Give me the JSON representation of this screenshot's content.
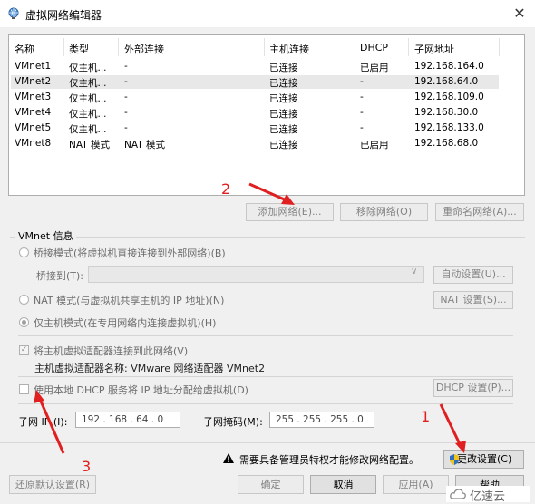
{
  "window": {
    "title": "虚拟网络编辑器",
    "close_glyph": "✕"
  },
  "table": {
    "columns": [
      "名称",
      "类型",
      "外部连接",
      "主机连接",
      "DHCP",
      "子网地址"
    ],
    "rows": [
      [
        "VMnet1",
        "仅主机...",
        "-",
        "已连接",
        "已启用",
        "192.168.164.0"
      ],
      [
        "VMnet2",
        "仅主机...",
        "-",
        "已连接",
        "-",
        "192.168.64.0"
      ],
      [
        "VMnet3",
        "仅主机...",
        "-",
        "已连接",
        "-",
        "192.168.109.0"
      ],
      [
        "VMnet4",
        "仅主机...",
        "-",
        "已连接",
        "-",
        "192.168.30.0"
      ],
      [
        "VMnet5",
        "仅主机...",
        "-",
        "已连接",
        "-",
        "192.168.133.0"
      ],
      [
        "VMnet8",
        "NAT 模式",
        "NAT 模式",
        "已连接",
        "已启用",
        "192.168.68.0"
      ]
    ],
    "selected_row": 1
  },
  "network_buttons": {
    "add": "添加网络(E)...",
    "remove": "移除网络(O)",
    "rename": "重命名网络(A)..."
  },
  "vmnet_info": {
    "group_title": "VMnet 信息",
    "bridge_mode": "桥接模式(将虚拟机直接连接到外部网络)(B)",
    "bridge_to_label": "桥接到(T):",
    "auto_settings": "自动设置(U)...",
    "nat_mode": "NAT 模式(与虚拟机共享主机的 IP 地址)(N)",
    "nat_settings": "NAT 设置(S)...",
    "host_only_mode": "仅主机模式(在专用网络内连接虚拟机)(H)",
    "connect_adapter": "将主机虚拟适配器连接到此网络(V)",
    "adapter_name": "主机虚拟适配器名称: VMware 网络适配器 VMnet2",
    "use_dhcp": "使用本地 DHCP 服务将 IP 地址分配给虚拟机(D)",
    "dhcp_settings": "DHCP 设置(P)...",
    "subnet_ip_label": "子网 IP (I):",
    "subnet_ip": "192 . 168 . 64  . 0",
    "subnet_mask_label": "子网掩码(M):",
    "subnet_mask": "255 . 255 . 255 . 0"
  },
  "admin": {
    "warning": "需要具备管理员特权才能修改网络配置。",
    "change_settings": "更改设置(C)"
  },
  "footer": {
    "restore": "还原默认设置(R)",
    "ok": "确定",
    "cancel": "取消",
    "apply": "应用(A)",
    "help": "帮助"
  },
  "annotations": {
    "n1": "1",
    "n2": "2",
    "n3": "3",
    "color": "#e02020"
  },
  "watermark": {
    "text": "亿速云"
  }
}
